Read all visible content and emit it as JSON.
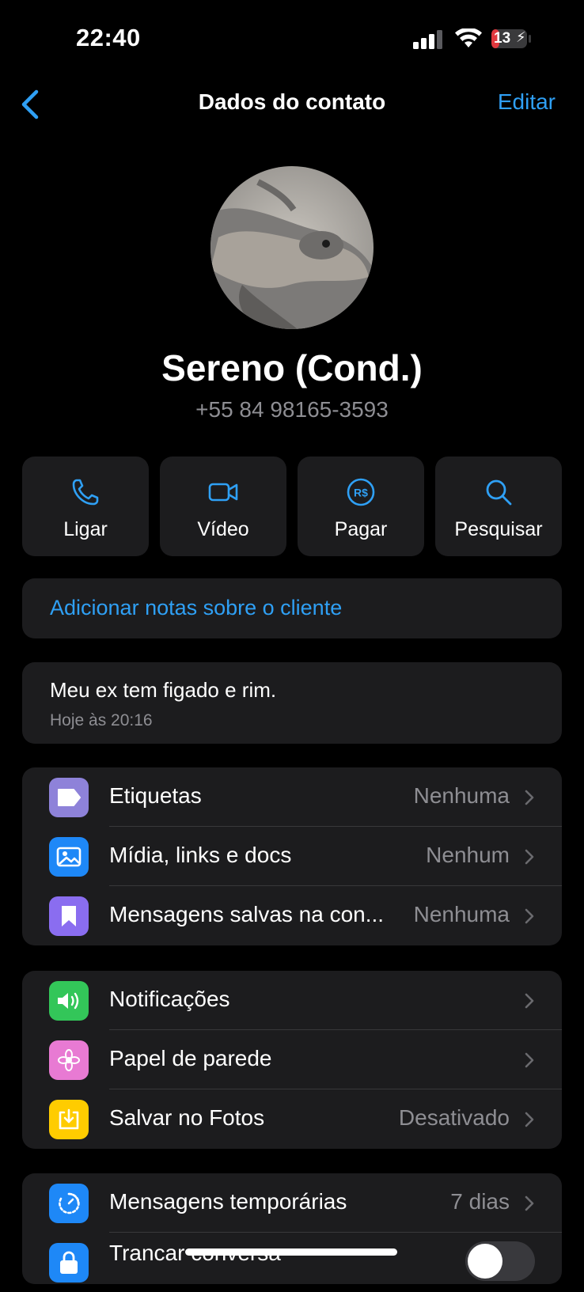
{
  "status": {
    "time": "22:40",
    "battery": "13"
  },
  "nav": {
    "title": "Dados do contato",
    "edit_label": "Editar"
  },
  "contact": {
    "name": "Sereno (Cond.)",
    "phone": "+55 84 98165-3593"
  },
  "actions": [
    {
      "label": "Ligar",
      "icon": "phone-icon"
    },
    {
      "label": "Vídeo",
      "icon": "video-icon"
    },
    {
      "label": "Pagar",
      "icon": "pay-icon"
    },
    {
      "label": "Pesquisar",
      "icon": "search-icon"
    }
  ],
  "pay_icon_text": "R$",
  "notes": {
    "add_label": "Adicionar notas sobre o cliente"
  },
  "message": {
    "text": "Meu ex tem figado e rim.",
    "time": "Hoje às 20:16"
  },
  "group1": [
    {
      "label": "Etiquetas",
      "value": "Nenhuma",
      "icon": "tag-icon",
      "color": "#8E82D9"
    },
    {
      "label": "Mídia, links e docs",
      "value": "Nenhum",
      "icon": "photo-icon",
      "color": "#1E88F7"
    },
    {
      "label": "Mensagens salvas na con...",
      "value": "Nenhuma",
      "icon": "bookmark-icon",
      "color": "#8A6DF0"
    }
  ],
  "group2": [
    {
      "label": "Notificações",
      "value": "",
      "icon": "speaker-icon",
      "color": "#33C659"
    },
    {
      "label": "Papel de parede",
      "value": "",
      "icon": "flower-icon",
      "color": "#E87AD3"
    },
    {
      "label": "Salvar no Fotos",
      "value": "Desativado",
      "icon": "download-icon",
      "color": "#FFCC00"
    }
  ],
  "group3": [
    {
      "label": "Mensagens temporárias",
      "value": "7 dias",
      "icon": "timer-icon",
      "color": "#1E88F7"
    },
    {
      "label": "Trancar conversa",
      "value": "",
      "icon": "lock-icon",
      "color": "#1E88F7"
    }
  ]
}
